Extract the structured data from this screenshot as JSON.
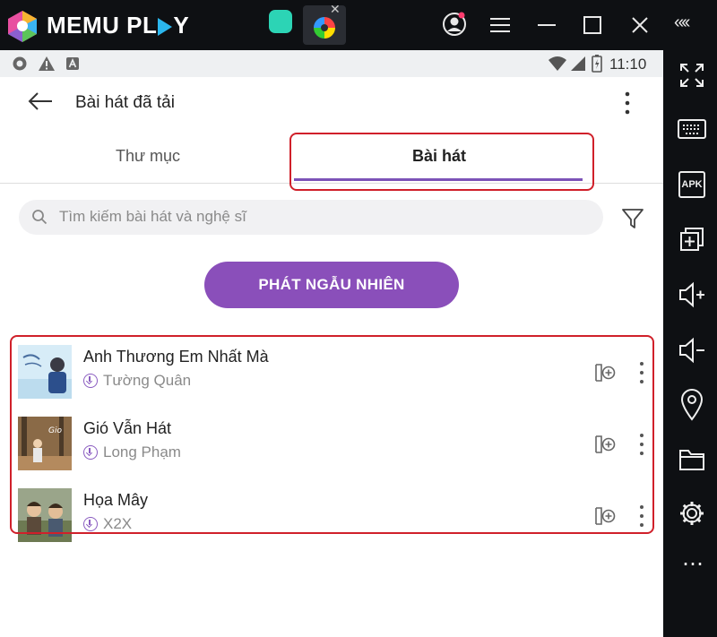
{
  "emulator": {
    "logo_text": "MEMU PL",
    "logo_text_end": "Y",
    "colors": {
      "bar": "#0e1013",
      "accent": "#2bb7ee"
    },
    "controls": [
      "user-icon",
      "menu-icon",
      "minimize-icon",
      "maximize-icon",
      "close-icon",
      "collapse-icon"
    ],
    "collapse_label": "«‹‹",
    "sidebar_icons": [
      "fullscreen-icon",
      "keyboard-icon",
      "apk-icon",
      "add-window-icon",
      "volume-up-icon",
      "volume-down-icon",
      "location-icon",
      "folder-icon",
      "settings-icon",
      "more-icon"
    ],
    "apk_label": "APK",
    "more_label": "⋯"
  },
  "statusbar": {
    "time": "11:10"
  },
  "app": {
    "title": "Bài hát đã tải",
    "tabs": [
      {
        "label": "Thư mục",
        "selected": false
      },
      {
        "label": "Bài hát",
        "selected": true
      }
    ],
    "search": {
      "placeholder": "Tìm kiếm bài hát và nghệ sĩ",
      "value": ""
    },
    "shuffle_label": "PHÁT NGẪU NHIÊN",
    "accent_color": "#8a4fba",
    "songs": [
      {
        "title": "Anh Thương Em Nhất Mà",
        "artist": "Tường Quân"
      },
      {
        "title": "Gió Vẫn Hát",
        "artist": "Long Phạm"
      },
      {
        "title": "Họa Mây",
        "artist": "X2X"
      }
    ]
  }
}
